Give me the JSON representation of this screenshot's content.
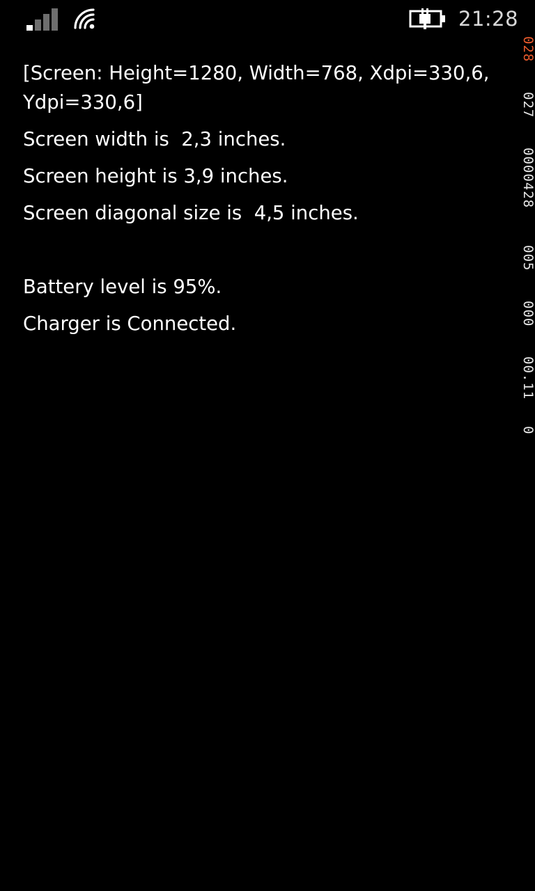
{
  "status_bar": {
    "time": "21:28",
    "icons": {
      "signal": "cellular-signal-icon",
      "wifi": "wifi-icon",
      "battery": "battery-charging-icon"
    },
    "signal_bars": 4,
    "signal_bars_filled": 1
  },
  "content": {
    "screen_info": "[Screen: Height=1280, Width=768, Xdpi=330,6, Ydpi=330,6]",
    "screen_width": "Screen width is  2,3 inches.",
    "screen_height": "Screen height is 3,9 inches.",
    "screen_diagonal": "Screen diagonal size is  4,5 inches.",
    "battery_level": "Battery level is 95%.",
    "charger_status": "Charger is Connected."
  },
  "debug_counters": [
    {
      "value": "028",
      "color": "#e85a2c"
    },
    {
      "value": "027",
      "color": "#e6e6e6"
    },
    {
      "value": "0000428",
      "color": "#e6e6e6"
    },
    {
      "value": "005",
      "color": "#e6e6e6"
    },
    {
      "value": "000",
      "color": "#e6e6e6"
    },
    {
      "value": "00.11",
      "color": "#e6e6e6"
    },
    {
      "value": "0",
      "color": "#e6e6e6"
    }
  ],
  "colors": {
    "background": "#000000",
    "text": "#ffffff",
    "clock": "#d8d8d8",
    "accent_counter": "#e85a2c",
    "signal_dim": "#6e6e6e"
  }
}
